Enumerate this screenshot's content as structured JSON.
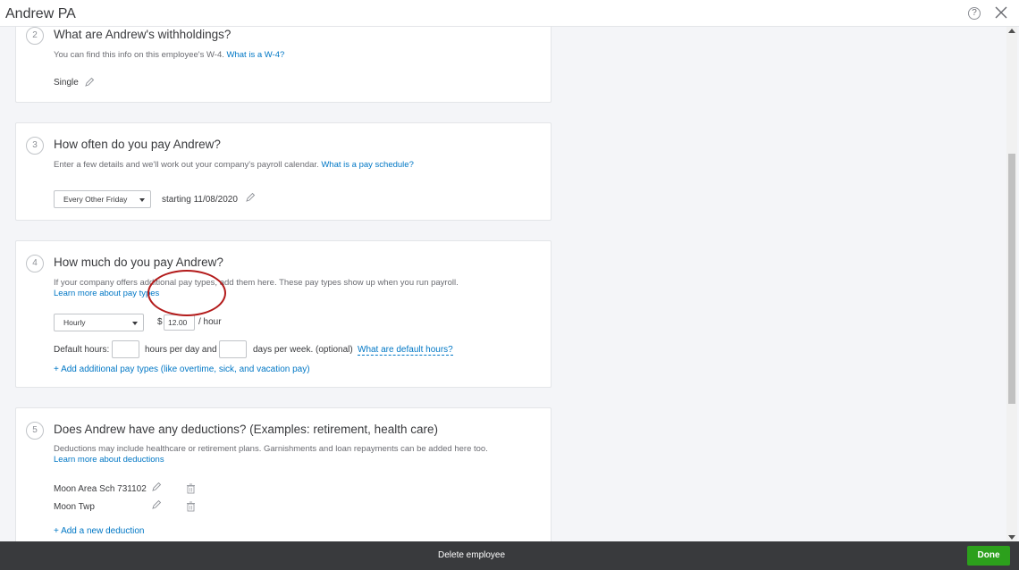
{
  "window": {
    "title": "Andrew PA"
  },
  "step2": {
    "number": "2",
    "title": "What are Andrew's withholdings?",
    "desc": "You can find this info on this employee's W-4.",
    "link": "What is a W-4?",
    "filing_status": "Single"
  },
  "step3": {
    "number": "3",
    "title": "How often do you pay Andrew?",
    "desc": "Enter a few details and we'll work out your company's payroll calendar.",
    "link": "What is a pay schedule?",
    "schedule": "Every Other Friday",
    "starting": "starting 11/08/2020"
  },
  "step4": {
    "number": "4",
    "title": "How much do you pay Andrew?",
    "desc": "If your company offers additional pay types, add them here. These pay types show up when you run payroll.",
    "link": "Learn more about pay types",
    "pay_type": "Hourly",
    "currency": "$",
    "rate": "12.00",
    "per": "/ hour",
    "default_hours_label": "Default hours:",
    "hours_per_day_label": "hours per day and",
    "days_per_week_label": "days per week.",
    "optional": "(optional)",
    "default_hours_link": "What are default hours?",
    "add_pay_types": "+ Add additional pay types (like overtime, sick, and vacation pay)"
  },
  "step5": {
    "number": "5",
    "title": "Does Andrew have any deductions? (Examples: retirement, health care)",
    "desc": "Deductions may include healthcare or retirement plans. Garnishments and loan repayments can be added here too.",
    "link": "Learn more about deductions",
    "deductions": [
      {
        "name": "Moon Area Sch 731102"
      },
      {
        "name": "Moon Twp"
      }
    ],
    "add_deduction": "+ Add a new deduction"
  },
  "footer": {
    "delete_label": "Delete employee",
    "done_label": "Done"
  },
  "colors": {
    "accent": "#0077c5",
    "done": "#2ca01c",
    "footer": "#393a3d",
    "highlight": "#b31b1b"
  }
}
